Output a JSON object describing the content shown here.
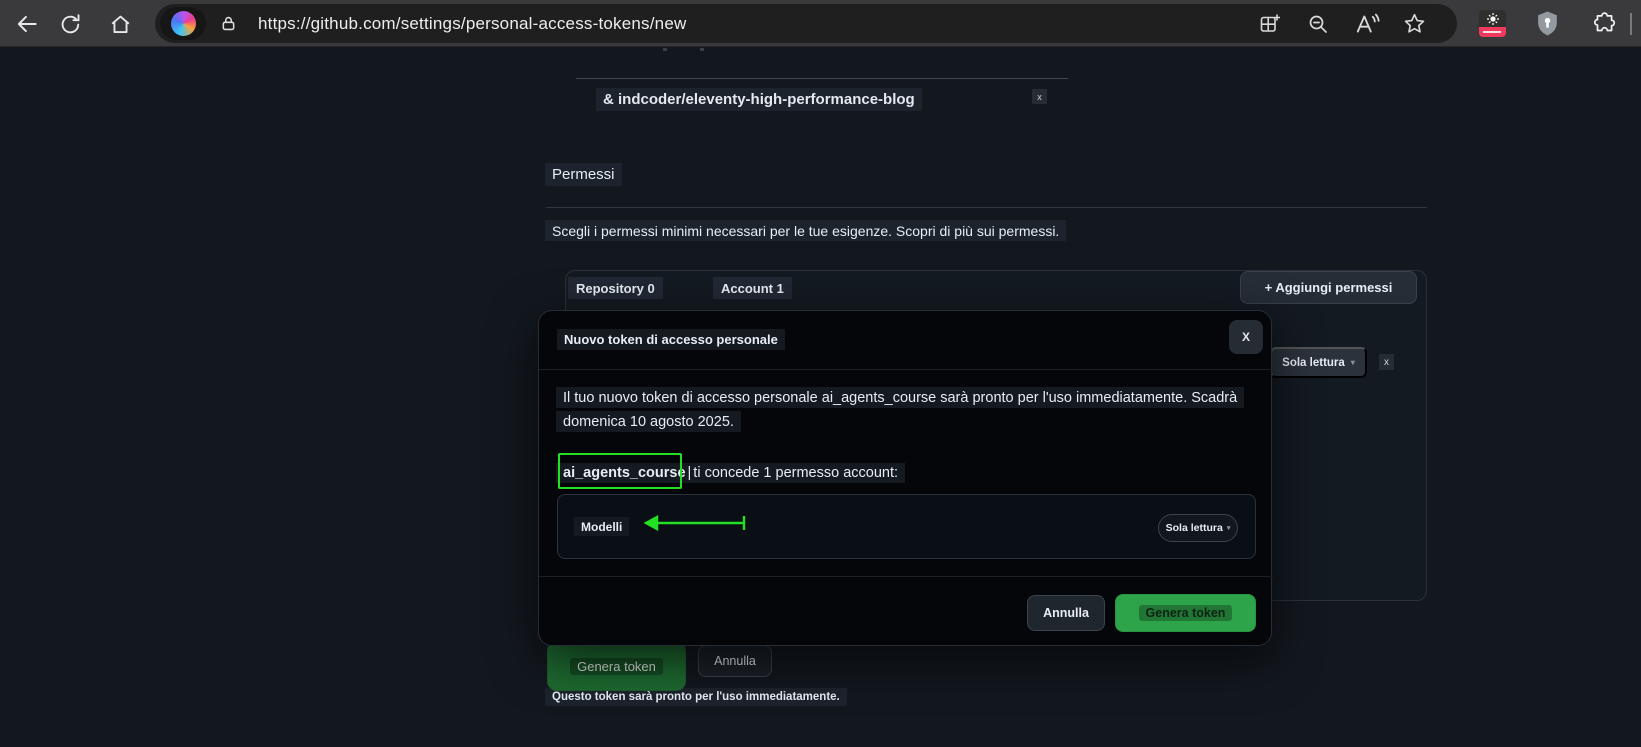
{
  "colors": {
    "annotation_green": "#24e024",
    "github_green": "#2ea44a",
    "toolbar_bg": "#3a3a3c",
    "page_bg": "#13181f",
    "modal_bg": "#04060a"
  },
  "icons": {
    "back": "left-arrow",
    "refresh": "circular-arrow",
    "home": "house",
    "copilot": "copilot-color-disc",
    "site_info": "padlock",
    "split_screen": "grid-plus",
    "zoom_out": "magnifier-minus",
    "read_aloud": "letter-a-sound-waves",
    "favorites": "star-outline",
    "extension_red": "red-badge-extension",
    "security_shield": "gray-shield-keyhole",
    "extensions": "puzzle-piece"
  },
  "toolbar": {
    "url": "https://github.com/settings/personal-access-tokens/new"
  },
  "page": {
    "repo_chip": {
      "label": "& indcoder/eleventy-high-performance-blog",
      "remove_glyph": "x"
    },
    "heading": "Permessi",
    "description": "Scegli i permessi minimi necessari per le tue esigenze. Scopri di più sui permessi.",
    "tabs": [
      {
        "label": "Repository 0"
      },
      {
        "label": "Account 1"
      }
    ],
    "add_permissions": "+ Aggiungi permessi",
    "readonly_dropdown": {
      "label": "Sola lettura",
      "caret": "▾",
      "remove_glyph": "x"
    },
    "generate_button": "Genera token",
    "cancel_button": "Annulla",
    "footnote": "Questo token sarà pronto per l'uso immediatamente."
  },
  "modal": {
    "title": "Nuovo token di accesso personale",
    "close_glyph": "X",
    "intro_line1": "Il tuo nuovo token di accesso personale ai_agents_course sarà pronto per l'uso immediatamente. Scadrà",
    "intro_line2": "domenica 10 agosto 2025.",
    "token_name": "ai_agents_course",
    "cursor_glyph": "|",
    "grant_text": "ti concede 1 permesso account:",
    "permission_row": {
      "name": "Modelli",
      "level": "Sola lettura",
      "caret": "▾"
    },
    "cancel_button": "Annulla",
    "generate_button": "Genera token"
  }
}
